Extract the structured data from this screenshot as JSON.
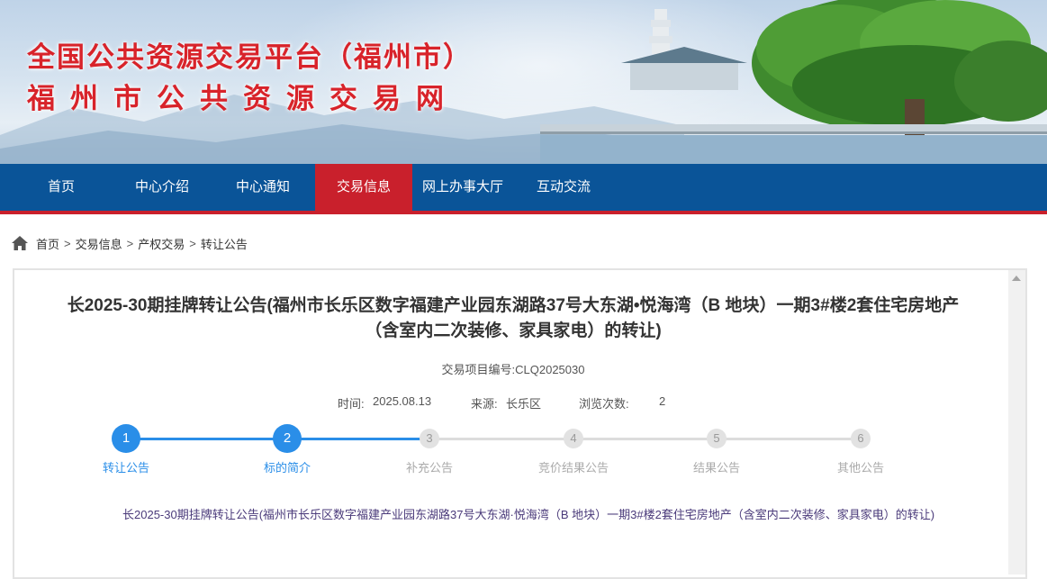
{
  "banner": {
    "title": "全国公共资源交易平台（福州市）",
    "subtitle": "福州市公共资源交易网"
  },
  "nav": {
    "items": [
      {
        "label": "首页",
        "active": false
      },
      {
        "label": "中心介绍",
        "active": false
      },
      {
        "label": "中心通知",
        "active": false
      },
      {
        "label": "交易信息",
        "active": true
      },
      {
        "label": "网上办事大厅",
        "active": false
      },
      {
        "label": "互动交流",
        "active": false
      }
    ]
  },
  "breadcrumb": {
    "icon": "home-icon",
    "items": [
      "首页",
      "交易信息",
      "产权交易",
      "转让公告"
    ],
    "separator": ">"
  },
  "article": {
    "title_line1": "长2025-30期挂牌转让公告(福州市长乐区数字福建产业园东湖路37号大东湖•悦海湾（B 地块）一期3#楼2套住宅房地产",
    "title_line2": "（含室内二次装修、家具家电）的转让)",
    "project_no": "交易项目编号:CLQ2025030",
    "time_label": "时间:",
    "time_value": "2025.08.13",
    "source_label": "来源:",
    "source_value": "长乐区",
    "views_label": "浏览次数:",
    "views_value": "2",
    "content_link": "长2025-30期挂牌转让公告(福州市长乐区数字福建产业园东湖路37号大东湖·悦海湾（B 地块）一期3#楼2套住宅房地产（含室内二次装修、家具家电）的转让)"
  },
  "steps": [
    {
      "num": "1",
      "label": "转让公告",
      "done": true
    },
    {
      "num": "2",
      "label": "标的简介",
      "done": true
    },
    {
      "num": "3",
      "label": "补充公告",
      "done": false
    },
    {
      "num": "4",
      "label": "竞价结果公告",
      "done": false
    },
    {
      "num": "5",
      "label": "结果公告",
      "done": false
    },
    {
      "num": "6",
      "label": "其他公告",
      "done": false
    }
  ],
  "colors": {
    "brand_blue": "#0a5498",
    "accent_red": "#c9202c",
    "title_red": "#d8232a",
    "step_blue": "#2a8ee8"
  }
}
